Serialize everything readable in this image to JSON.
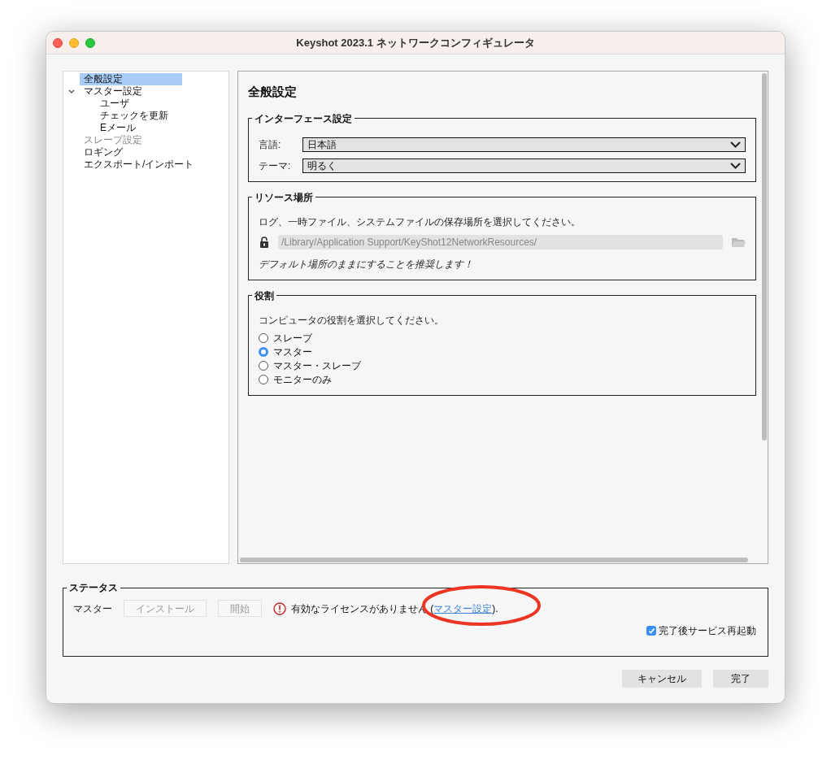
{
  "window": {
    "title": "Keyshot 2023.1 ネットワークコンフィギュレータ"
  },
  "sidebar": {
    "items": [
      {
        "label": "全般設定",
        "selected": true,
        "disabled": false
      },
      {
        "label": "マスター設定",
        "selected": false,
        "disabled": false,
        "expanded": true,
        "children": [
          {
            "label": "ユーザ",
            "selected": false,
            "disabled": false
          },
          {
            "label": "チェックを更新",
            "selected": false,
            "disabled": false
          },
          {
            "label": "Eメール",
            "selected": false,
            "disabled": false
          }
        ]
      },
      {
        "label": "スレーブ設定",
        "selected": false,
        "disabled": true
      },
      {
        "label": "ロギング",
        "selected": false,
        "disabled": false
      },
      {
        "label": "エクスポート/インポート",
        "selected": false,
        "disabled": false
      }
    ]
  },
  "panel": {
    "title": "全般設定",
    "interface": {
      "title": "インターフェース設定",
      "fields": [
        {
          "label": "言語:",
          "value": "日本語"
        },
        {
          "label": "テーマ:",
          "value": "明るく"
        }
      ]
    },
    "resources": {
      "title": "リソース場所",
      "description": "ログ、一時ファイル、システムファイルの保存場所を選択してください。",
      "path": "/Library/Application Support/KeyShot12NetworkResources/",
      "note": "デフォルト場所のままにすることを推奨します！"
    },
    "role": {
      "title": "役割",
      "description": "コンピュータの役割を選択してください。",
      "options": [
        {
          "label": "スレーブ",
          "selected": false
        },
        {
          "label": "マスター",
          "selected": true
        },
        {
          "label": "マスター・スレーブ",
          "selected": false
        },
        {
          "label": "モニターのみ",
          "selected": false
        }
      ]
    }
  },
  "status": {
    "title": "ステータス",
    "label": "マスター",
    "buttons": [
      {
        "label": "インストール",
        "disabled": true
      },
      {
        "label": "開始",
        "disabled": true
      }
    ],
    "message": "有効なライセンスがありません (",
    "link": "マスター設定",
    "message_end": ").",
    "restart": {
      "label": "完了後サービス再起動",
      "checked": true
    }
  },
  "footer": {
    "buttons": [
      "キャンセル",
      "完了"
    ]
  }
}
